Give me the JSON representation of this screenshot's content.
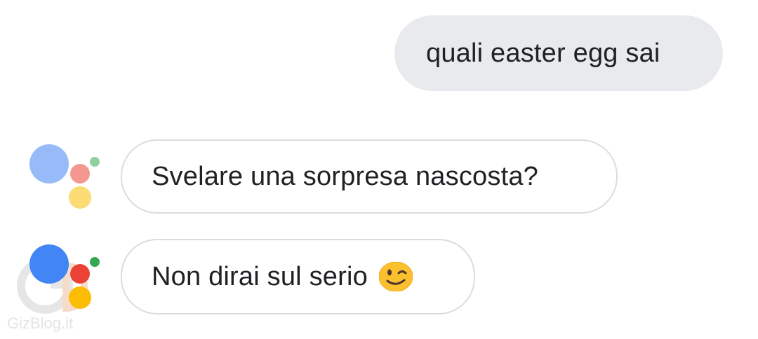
{
  "conversation": {
    "user_message": "quali easter egg sai",
    "assistant_messages": [
      {
        "text": "Svelare una sorpresa nascosta?",
        "avatar_state": "faded"
      },
      {
        "text": "Non dirai sul serio",
        "emoji": "winking-face-emoji",
        "avatar_state": "active"
      }
    ]
  },
  "watermark": {
    "text": "GizBlog.it"
  },
  "colors": {
    "user_bubble_bg": "#e8eaed",
    "assistant_bubble_border": "#dadce0",
    "text": "#202124",
    "google_blue": "#4285f4",
    "google_red": "#ea4335",
    "google_yellow": "#fbbc04",
    "google_green": "#34a853"
  },
  "icons": {
    "assistant_avatar": "google-assistant-dots-icon",
    "emoji": "winking-face-emoji"
  }
}
